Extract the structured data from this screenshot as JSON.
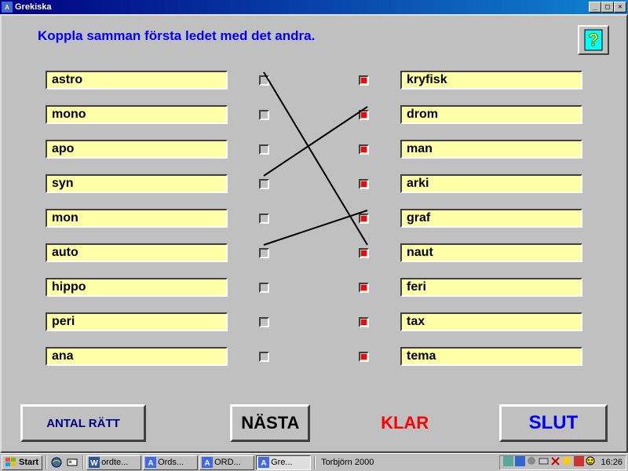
{
  "window": {
    "title": "Grekiska"
  },
  "instruction": "Koppla samman första ledet med det andra.",
  "left_words": [
    "astro",
    "mono",
    "apo",
    "syn",
    "mon",
    "auto",
    "hippo",
    "peri",
    "ana"
  ],
  "right_words": [
    "kryfisk",
    "drom",
    "man",
    "arki",
    "graf",
    "naut",
    "feri",
    "tax",
    "tema"
  ],
  "connections": [
    {
      "from": 0,
      "to": 5
    },
    {
      "from": 3,
      "to": 1
    },
    {
      "from": 5,
      "to": 4
    }
  ],
  "buttons": {
    "antal": "ANTAL RÄTT",
    "next": "NÄSTA",
    "done": "KLAR",
    "quit": "SLUT"
  },
  "taskbar": {
    "start": "Start",
    "items": [
      {
        "label": "ordte...",
        "color": "#2b579a",
        "glyph": "W"
      },
      {
        "label": "Ords...",
        "color": "#4169e1",
        "glyph": "A"
      },
      {
        "label": "ORD...",
        "color": "#4169e1",
        "glyph": "A"
      },
      {
        "label": "Gre...",
        "color": "#4169e1",
        "glyph": "A",
        "active": true
      }
    ],
    "user": "Torbjörn 2000",
    "clock": "16:26"
  }
}
